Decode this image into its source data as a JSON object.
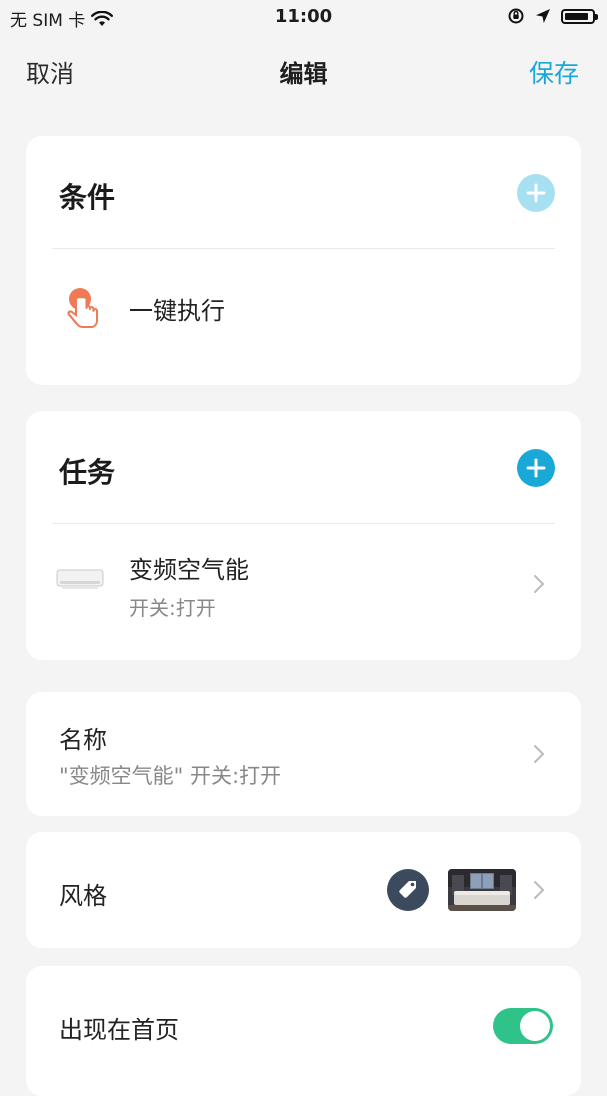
{
  "status": {
    "carrier": "无 SIM 卡",
    "time": "11:00",
    "battery_level": 0.9
  },
  "nav": {
    "cancel": "取消",
    "title": "编辑",
    "save": "保存"
  },
  "conditions": {
    "title": "条件",
    "item_label": "一键执行"
  },
  "tasks": {
    "title": "任务",
    "device_name": "变频空气能",
    "device_action": "开关:打开"
  },
  "name_row": {
    "label": "名称",
    "value": "\"变频空气能\" 开关:打开"
  },
  "style_row": {
    "label": "风格"
  },
  "home_row": {
    "label": "出现在首页",
    "toggle_on": true
  },
  "colors": {
    "accent": "#1aa8d8",
    "add_disabled": "#a7e0f0",
    "toggle": "#2fc38a",
    "hand": "#ef7a55",
    "tag_bg": "#3c4a5e"
  }
}
